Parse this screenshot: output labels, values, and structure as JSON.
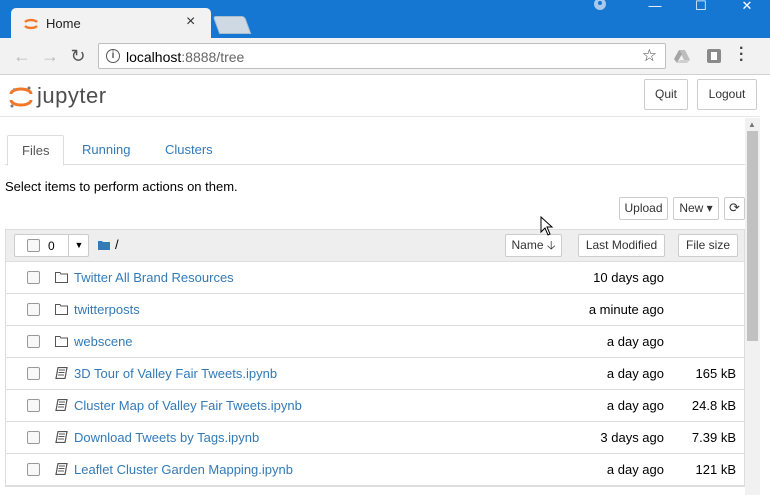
{
  "browser": {
    "tab_title": "Home",
    "tab_close": "×",
    "url_host": "localhost",
    "url_rest": ":8888/tree",
    "win_min": "—",
    "win_max": "☐",
    "win_close": "✕"
  },
  "app": {
    "logo_text": "jupyter",
    "quit_label": "Quit",
    "logout_label": "Logout"
  },
  "tabs": [
    {
      "label": "Files",
      "active": true
    },
    {
      "label": "Running",
      "active": false
    },
    {
      "label": "Clusters",
      "active": false
    }
  ],
  "hint": "Select items to perform actions on them.",
  "actions": {
    "upload_label": "Upload",
    "new_label": "New ▾",
    "refresh_glyph": "⟳"
  },
  "list_header": {
    "selected_count": "0",
    "root_path": "/",
    "sort_name_label": "Name 🡣",
    "last_modified_label": "Last Modified",
    "file_size_label": "File size"
  },
  "rows": [
    {
      "type": "folder",
      "name": "Twitter All Brand Resources",
      "modified": "10 days ago",
      "size": ""
    },
    {
      "type": "folder",
      "name": "twitterposts",
      "modified": "a minute ago",
      "size": ""
    },
    {
      "type": "folder",
      "name": "webscene",
      "modified": "a day ago",
      "size": ""
    },
    {
      "type": "notebook",
      "name": "3D Tour of Valley Fair Tweets.ipynb",
      "modified": "a day ago",
      "size": "165 kB"
    },
    {
      "type": "notebook",
      "name": "Cluster Map of Valley Fair Tweets.ipynb",
      "modified": "a day ago",
      "size": "24.8 kB"
    },
    {
      "type": "notebook",
      "name": "Download Tweets by Tags.ipynb",
      "modified": "3 days ago",
      "size": "7.39 kB"
    },
    {
      "type": "notebook",
      "name": "Leaflet Cluster Garden Mapping.ipynb",
      "modified": "a day ago",
      "size": "121 kB"
    }
  ],
  "colors": {
    "titlebar": "#1677d2",
    "link": "#337ab7",
    "jupyter_orange": "#f37726"
  }
}
